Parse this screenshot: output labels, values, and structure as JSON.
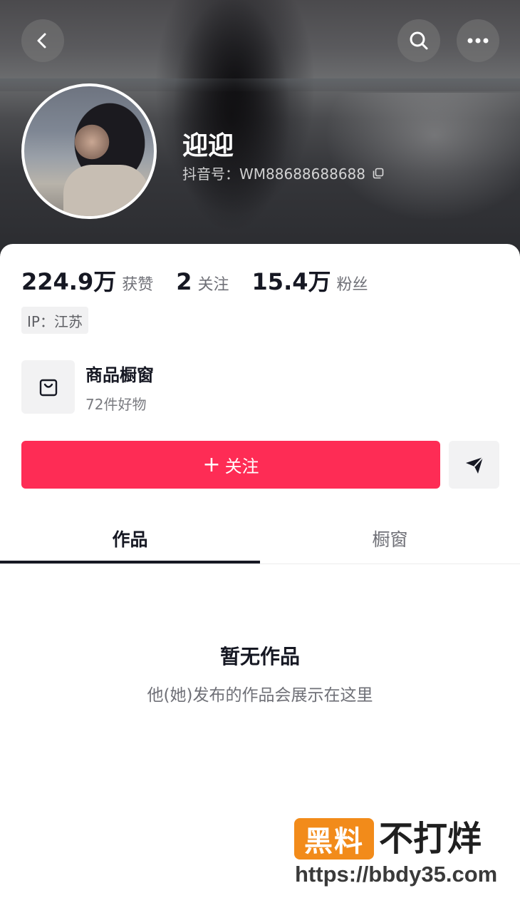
{
  "header": {
    "back_icon": "chevron-left-icon",
    "search_icon": "search-icon",
    "more_icon": "more-dots-icon"
  },
  "profile": {
    "username": "迎迎",
    "douyin_id": "抖音号：WM88688688688",
    "copy_icon": "copy-icon"
  },
  "stats": [
    {
      "value": "224.9万",
      "label": "获赞"
    },
    {
      "value": "2",
      "label": "关注"
    },
    {
      "value": "15.4万",
      "label": "粉丝"
    }
  ],
  "ip_tag": "IP：江苏",
  "shop": {
    "title": "商品橱窗",
    "subtitle": "72件好物",
    "icon": "shopping-bag-icon"
  },
  "actions": {
    "follow_plus": "+",
    "follow_label": "关注",
    "share_icon": "send-icon",
    "follow_color": "#fe2c55"
  },
  "tabs": [
    {
      "label": "作品",
      "active": true
    },
    {
      "label": "橱窗",
      "active": false
    }
  ],
  "empty_state": {
    "title": "暂无作品",
    "subtitle": "他(她)发布的作品会展示在这里"
  },
  "watermark": {
    "box_text": "黑料",
    "text": "不打烊",
    "url": "https://bbdy35.com",
    "box_color": "#f28b1a"
  }
}
